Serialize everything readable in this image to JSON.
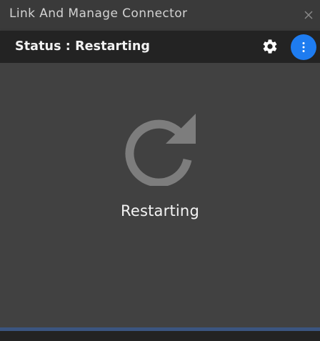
{
  "window": {
    "title": "Link And Manage Connector"
  },
  "header": {
    "status_text": "Status : Restarting"
  },
  "main": {
    "state_label": "Restarting"
  },
  "icons": {
    "close": "close-icon",
    "settings": "gear-icon",
    "more": "vertical-ellipsis-icon",
    "state": "restart-icon"
  },
  "colors": {
    "accent_blue": "#1e7cf0",
    "status_bar_bg": "#232323",
    "content_bg": "#414141",
    "icon_gray": "#7d7d7d",
    "bottom_accent": "#3b5580"
  }
}
